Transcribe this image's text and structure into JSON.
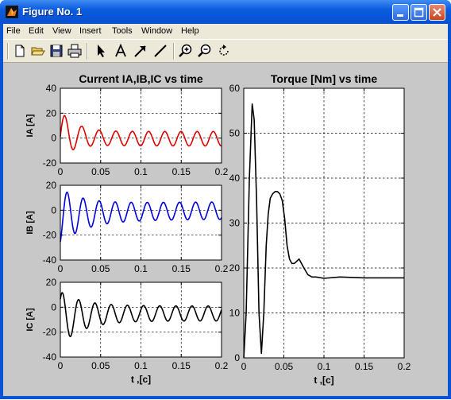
{
  "window": {
    "title": "Figure No. 1"
  },
  "menu": [
    "File",
    "Edit",
    "View",
    "Insert",
    "Tools",
    "Window",
    "Help"
  ],
  "toolbar_icons": [
    "new-file-icon",
    "open-folder-icon",
    "save-icon",
    "print-icon",
    "arrow-pointer-icon",
    "insert-text-icon",
    "insert-arrow-icon",
    "insert-line-icon",
    "zoom-in-icon",
    "zoom-out-icon",
    "rotate-3d-icon"
  ],
  "chart_data": [
    {
      "type": "line",
      "title": "Current IA,IB,IC vs time",
      "xlabel": "",
      "ylabel": "IA [A]",
      "xlim": [
        0,
        0.2
      ],
      "ylim": [
        -20,
        40
      ],
      "xticks": [
        0,
        0.05,
        0.1,
        0.15,
        0.2
      ],
      "yticks": [
        -20,
        0,
        20,
        40
      ],
      "grid": true,
      "series": [
        {
          "color": "#e00000",
          "kind": "current-a"
        }
      ]
    },
    {
      "type": "line",
      "title": "",
      "xlabel": "",
      "ylabel": "IB [A]",
      "xlim": [
        0,
        0.2
      ],
      "ylim": [
        -40,
        20
      ],
      "xticks": [
        0,
        0.05,
        0.1,
        0.15,
        0.2
      ],
      "yticks": [
        -40,
        -20,
        0,
        20
      ],
      "grid": true,
      "series": [
        {
          "color": "#0000e0",
          "kind": "current-b"
        }
      ]
    },
    {
      "type": "line",
      "title": "",
      "xlabel": "t ,[c]",
      "ylabel": "IC [A]",
      "xlim": [
        0,
        0.2
      ],
      "ylim": [
        -40,
        20
      ],
      "xticks": [
        0,
        0.05,
        0.1,
        0.15,
        0.2
      ],
      "yticks": [
        -40,
        -20,
        0,
        20
      ],
      "grid": true,
      "series": [
        {
          "color": "#000000",
          "kind": "current-c"
        }
      ]
    },
    {
      "type": "line",
      "title": "Torque [Nm] vs time",
      "xlabel": "t ,[c]",
      "ylabel": "",
      "xlim": [
        0,
        0.2
      ],
      "ylim": [
        0,
        60
      ],
      "xticks": [
        0,
        0.05,
        0.1,
        0.15,
        0.2
      ],
      "yticks": [
        0,
        10,
        20,
        30,
        40,
        50,
        60
      ],
      "grid": true,
      "series": [
        {
          "color": "#000000",
          "x": [
            0,
            0.003,
            0.007,
            0.0105,
            0.013,
            0.016,
            0.019,
            0.022,
            0.025,
            0.028,
            0.0305,
            0.033,
            0.036,
            0.039,
            0.042,
            0.045,
            0.048,
            0.051,
            0.054,
            0.057,
            0.06,
            0.063,
            0.066,
            0.069,
            0.072,
            0.075,
            0.08,
            0.085,
            0.09,
            0.1,
            0.12,
            0.15,
            0.2
          ],
          "y": [
            0,
            10,
            40,
            56.5,
            53,
            35,
            10,
            1,
            10,
            25,
            32,
            35.5,
            36.5,
            37,
            37,
            36.5,
            35,
            31,
            25,
            22,
            21,
            21,
            21.5,
            22,
            21,
            20,
            18.5,
            18,
            18,
            17.7,
            18,
            17.8,
            17.8
          ]
        }
      ]
    }
  ]
}
